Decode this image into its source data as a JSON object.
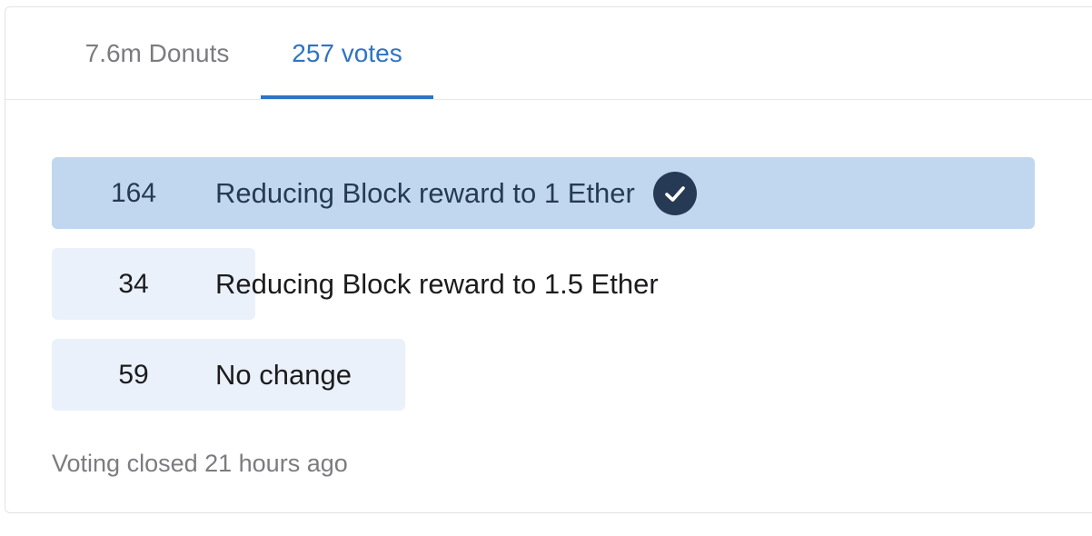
{
  "tabs": [
    {
      "label": "7.6m Donuts",
      "active": false
    },
    {
      "label": "257 votes",
      "active": true
    }
  ],
  "poll": {
    "total_votes": 257,
    "options": [
      {
        "count": "164",
        "label": "Reducing Block reward to 1 Ether",
        "winner": true
      },
      {
        "count": "34",
        "label": "Reducing Block reward to 1.5 Ether",
        "winner": false
      },
      {
        "count": "59",
        "label": "No change",
        "winner": false
      }
    ],
    "status": "Voting closed 21 hours ago"
  },
  "icons": {
    "winner_check": "check-circle-icon"
  },
  "colors": {
    "accent": "#2e74c3",
    "winner_fill": "#c0d7ef",
    "option_fill": "#eaf1fa",
    "check_circle": "#273a55",
    "muted_text": "#7c7c80"
  }
}
